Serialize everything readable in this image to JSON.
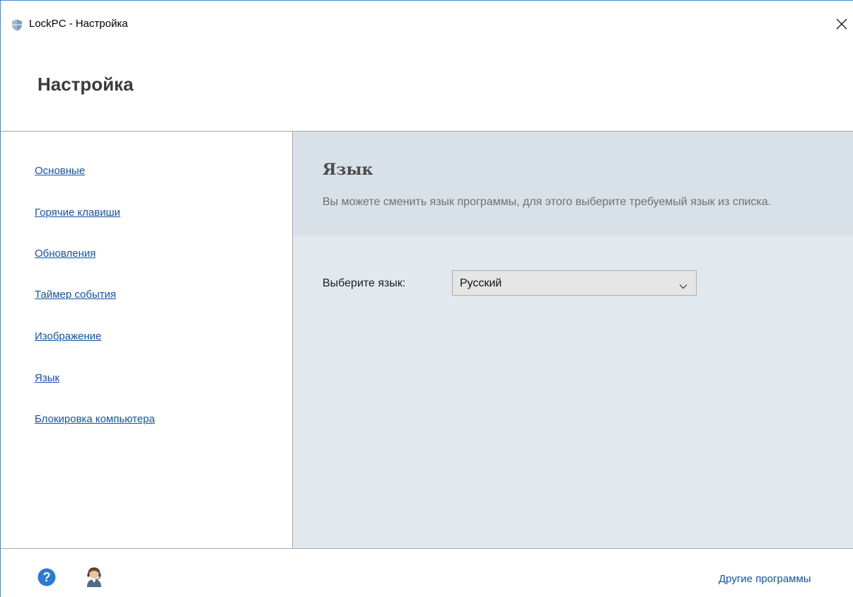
{
  "window": {
    "title": "LockPC - Настройка",
    "app_icon": "shield-icon",
    "close_icon": "close-icon"
  },
  "header": {
    "title": "Настройка"
  },
  "sidebar": {
    "items": [
      {
        "label": "Основные"
      },
      {
        "label": "Горячие клавиши"
      },
      {
        "label": "Обновления"
      },
      {
        "label": "Таймер события"
      },
      {
        "label": "Изображение"
      },
      {
        "label": "Язык"
      },
      {
        "label": "Блокировка компьютера"
      }
    ]
  },
  "content": {
    "title": "Язык",
    "description": "Вы можете сменить язык программы, для этого выберите требуемый язык из списка.",
    "language_label": "Выберите язык:",
    "language_value": "Русский"
  },
  "footer": {
    "help_icon": "help-icon",
    "support_icon": "support-agent-icon",
    "other_programs": "Другие программы"
  },
  "colors": {
    "link": "#1452a8",
    "content_bg": "#e2e9ee",
    "content_header_bg": "#d8e1e7",
    "help_icon": "#2a7bd1",
    "window_border": "#4a8ad4"
  }
}
